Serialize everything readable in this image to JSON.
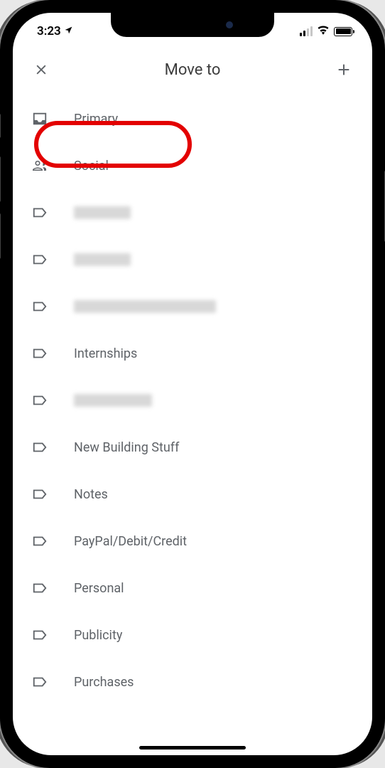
{
  "status": {
    "time": "3:23",
    "location_icon": "nav-arrow"
  },
  "header": {
    "title": "Move to"
  },
  "list": {
    "items": [
      {
        "icon": "inbox",
        "label": "Primary",
        "highlighted": true
      },
      {
        "icon": "social",
        "label": "Social"
      },
      {
        "icon": "label",
        "label": "",
        "blurred": "blur1"
      },
      {
        "icon": "label",
        "label": "",
        "blurred": "blur2"
      },
      {
        "icon": "label",
        "label": "",
        "blurred": "blur3"
      },
      {
        "icon": "label",
        "label": "Internships"
      },
      {
        "icon": "label",
        "label": "",
        "blurred": "blur4"
      },
      {
        "icon": "label",
        "label": "New Building Stuff"
      },
      {
        "icon": "label",
        "label": "Notes"
      },
      {
        "icon": "label",
        "label": "PayPal/Debit/Credit"
      },
      {
        "icon": "label",
        "label": "Personal"
      },
      {
        "icon": "label",
        "label": "Publicity"
      },
      {
        "icon": "label",
        "label": "Purchases"
      }
    ]
  }
}
